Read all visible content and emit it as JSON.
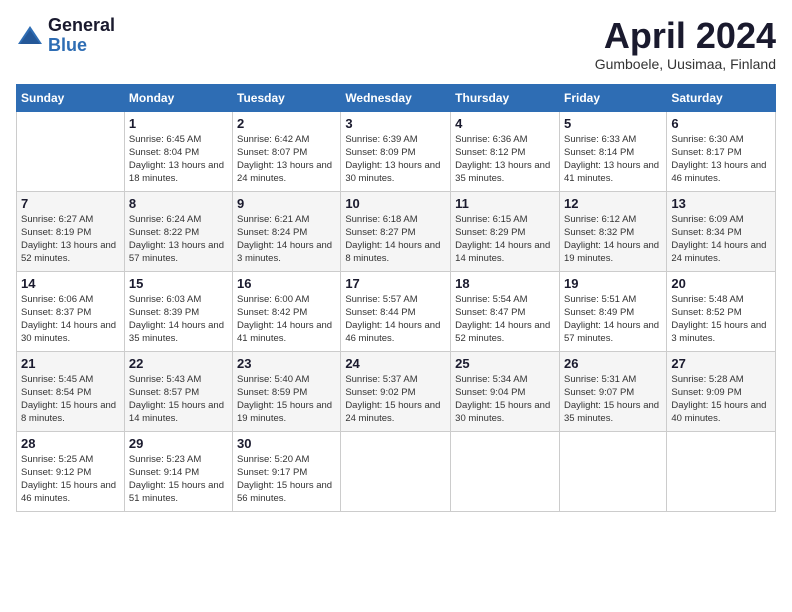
{
  "header": {
    "logo_general": "General",
    "logo_blue": "Blue",
    "title": "April 2024",
    "location": "Gumboele, Uusimaa, Finland"
  },
  "weekdays": [
    "Sunday",
    "Monday",
    "Tuesday",
    "Wednesday",
    "Thursday",
    "Friday",
    "Saturday"
  ],
  "weeks": [
    [
      {
        "day": "",
        "sunrise": "",
        "sunset": "",
        "daylight": ""
      },
      {
        "day": "1",
        "sunrise": "Sunrise: 6:45 AM",
        "sunset": "Sunset: 8:04 PM",
        "daylight": "Daylight: 13 hours and 18 minutes."
      },
      {
        "day": "2",
        "sunrise": "Sunrise: 6:42 AM",
        "sunset": "Sunset: 8:07 PM",
        "daylight": "Daylight: 13 hours and 24 minutes."
      },
      {
        "day": "3",
        "sunrise": "Sunrise: 6:39 AM",
        "sunset": "Sunset: 8:09 PM",
        "daylight": "Daylight: 13 hours and 30 minutes."
      },
      {
        "day": "4",
        "sunrise": "Sunrise: 6:36 AM",
        "sunset": "Sunset: 8:12 PM",
        "daylight": "Daylight: 13 hours and 35 minutes."
      },
      {
        "day": "5",
        "sunrise": "Sunrise: 6:33 AM",
        "sunset": "Sunset: 8:14 PM",
        "daylight": "Daylight: 13 hours and 41 minutes."
      },
      {
        "day": "6",
        "sunrise": "Sunrise: 6:30 AM",
        "sunset": "Sunset: 8:17 PM",
        "daylight": "Daylight: 13 hours and 46 minutes."
      }
    ],
    [
      {
        "day": "7",
        "sunrise": "Sunrise: 6:27 AM",
        "sunset": "Sunset: 8:19 PM",
        "daylight": "Daylight: 13 hours and 52 minutes."
      },
      {
        "day": "8",
        "sunrise": "Sunrise: 6:24 AM",
        "sunset": "Sunset: 8:22 PM",
        "daylight": "Daylight: 13 hours and 57 minutes."
      },
      {
        "day": "9",
        "sunrise": "Sunrise: 6:21 AM",
        "sunset": "Sunset: 8:24 PM",
        "daylight": "Daylight: 14 hours and 3 minutes."
      },
      {
        "day": "10",
        "sunrise": "Sunrise: 6:18 AM",
        "sunset": "Sunset: 8:27 PM",
        "daylight": "Daylight: 14 hours and 8 minutes."
      },
      {
        "day": "11",
        "sunrise": "Sunrise: 6:15 AM",
        "sunset": "Sunset: 8:29 PM",
        "daylight": "Daylight: 14 hours and 14 minutes."
      },
      {
        "day": "12",
        "sunrise": "Sunrise: 6:12 AM",
        "sunset": "Sunset: 8:32 PM",
        "daylight": "Daylight: 14 hours and 19 minutes."
      },
      {
        "day": "13",
        "sunrise": "Sunrise: 6:09 AM",
        "sunset": "Sunset: 8:34 PM",
        "daylight": "Daylight: 14 hours and 24 minutes."
      }
    ],
    [
      {
        "day": "14",
        "sunrise": "Sunrise: 6:06 AM",
        "sunset": "Sunset: 8:37 PM",
        "daylight": "Daylight: 14 hours and 30 minutes."
      },
      {
        "day": "15",
        "sunrise": "Sunrise: 6:03 AM",
        "sunset": "Sunset: 8:39 PM",
        "daylight": "Daylight: 14 hours and 35 minutes."
      },
      {
        "day": "16",
        "sunrise": "Sunrise: 6:00 AM",
        "sunset": "Sunset: 8:42 PM",
        "daylight": "Daylight: 14 hours and 41 minutes."
      },
      {
        "day": "17",
        "sunrise": "Sunrise: 5:57 AM",
        "sunset": "Sunset: 8:44 PM",
        "daylight": "Daylight: 14 hours and 46 minutes."
      },
      {
        "day": "18",
        "sunrise": "Sunrise: 5:54 AM",
        "sunset": "Sunset: 8:47 PM",
        "daylight": "Daylight: 14 hours and 52 minutes."
      },
      {
        "day": "19",
        "sunrise": "Sunrise: 5:51 AM",
        "sunset": "Sunset: 8:49 PM",
        "daylight": "Daylight: 14 hours and 57 minutes."
      },
      {
        "day": "20",
        "sunrise": "Sunrise: 5:48 AM",
        "sunset": "Sunset: 8:52 PM",
        "daylight": "Daylight: 15 hours and 3 minutes."
      }
    ],
    [
      {
        "day": "21",
        "sunrise": "Sunrise: 5:45 AM",
        "sunset": "Sunset: 8:54 PM",
        "daylight": "Daylight: 15 hours and 8 minutes."
      },
      {
        "day": "22",
        "sunrise": "Sunrise: 5:43 AM",
        "sunset": "Sunset: 8:57 PM",
        "daylight": "Daylight: 15 hours and 14 minutes."
      },
      {
        "day": "23",
        "sunrise": "Sunrise: 5:40 AM",
        "sunset": "Sunset: 8:59 PM",
        "daylight": "Daylight: 15 hours and 19 minutes."
      },
      {
        "day": "24",
        "sunrise": "Sunrise: 5:37 AM",
        "sunset": "Sunset: 9:02 PM",
        "daylight": "Daylight: 15 hours and 24 minutes."
      },
      {
        "day": "25",
        "sunrise": "Sunrise: 5:34 AM",
        "sunset": "Sunset: 9:04 PM",
        "daylight": "Daylight: 15 hours and 30 minutes."
      },
      {
        "day": "26",
        "sunrise": "Sunrise: 5:31 AM",
        "sunset": "Sunset: 9:07 PM",
        "daylight": "Daylight: 15 hours and 35 minutes."
      },
      {
        "day": "27",
        "sunrise": "Sunrise: 5:28 AM",
        "sunset": "Sunset: 9:09 PM",
        "daylight": "Daylight: 15 hours and 40 minutes."
      }
    ],
    [
      {
        "day": "28",
        "sunrise": "Sunrise: 5:25 AM",
        "sunset": "Sunset: 9:12 PM",
        "daylight": "Daylight: 15 hours and 46 minutes."
      },
      {
        "day": "29",
        "sunrise": "Sunrise: 5:23 AM",
        "sunset": "Sunset: 9:14 PM",
        "daylight": "Daylight: 15 hours and 51 minutes."
      },
      {
        "day": "30",
        "sunrise": "Sunrise: 5:20 AM",
        "sunset": "Sunset: 9:17 PM",
        "daylight": "Daylight: 15 hours and 56 minutes."
      },
      {
        "day": "",
        "sunrise": "",
        "sunset": "",
        "daylight": ""
      },
      {
        "day": "",
        "sunrise": "",
        "sunset": "",
        "daylight": ""
      },
      {
        "day": "",
        "sunrise": "",
        "sunset": "",
        "daylight": ""
      },
      {
        "day": "",
        "sunrise": "",
        "sunset": "",
        "daylight": ""
      }
    ]
  ]
}
